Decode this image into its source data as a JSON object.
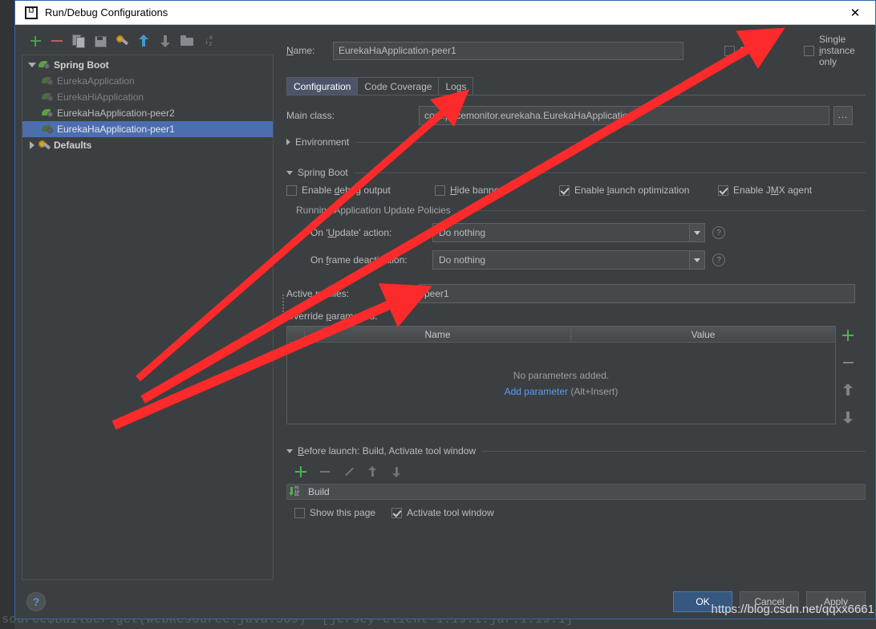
{
  "window": {
    "title": "Run/Debug Configurations",
    "logo_icon": "intellij-idea-logo",
    "close_icon": "close-icon"
  },
  "toolbar": {
    "icons": [
      {
        "name": "add-icon",
        "glyph": "+"
      },
      {
        "name": "remove-icon",
        "glyph": "−"
      },
      {
        "name": "copy-icon",
        "glyph": "copy"
      },
      {
        "name": "save-icon",
        "glyph": "save"
      },
      {
        "name": "edit-defaults-icon",
        "glyph": "gear"
      },
      {
        "name": "move-up-icon",
        "glyph": "up"
      },
      {
        "name": "move-down-icon",
        "glyph": "down"
      },
      {
        "name": "folder-icon",
        "glyph": "folder"
      },
      {
        "name": "sort-icon",
        "glyph": "↓az"
      }
    ]
  },
  "tree": {
    "nodes": [
      {
        "label": "Spring Boot",
        "icon": "spring-boot-icon",
        "style": "bold",
        "twisty": "down",
        "indent": 0,
        "selected": false
      },
      {
        "label": "EurekaApplication",
        "icon": "spring-boot-icon",
        "style": "dim",
        "twisty": "none",
        "indent": 1,
        "selected": false
      },
      {
        "label": "EurekaHiApplication",
        "icon": "spring-boot-icon",
        "style": "dim",
        "twisty": "none",
        "indent": 1,
        "selected": false
      },
      {
        "label": "EurekaHaApplication-peer2",
        "icon": "spring-boot-icon",
        "style": "normal",
        "twisty": "none",
        "indent": 1,
        "selected": false
      },
      {
        "label": "EurekaHaApplication-peer1",
        "icon": "spring-boot-icon",
        "style": "dim",
        "twisty": "none",
        "indent": 1,
        "selected": true
      },
      {
        "label": "Defaults",
        "icon": "wrench-icon",
        "style": "bold",
        "twisty": "right",
        "indent": 0,
        "selected": false
      }
    ]
  },
  "form": {
    "name_label": "Name:",
    "name_value": "EurekaHaApplication-peer1",
    "share_label": "Share",
    "share_checked": false,
    "single_instance_label": "Single instance only",
    "single_instance_checked": false,
    "tabs": [
      {
        "label": "Configuration",
        "active": true
      },
      {
        "label": "Code Coverage",
        "active": false
      },
      {
        "label": "Logs",
        "active": false
      }
    ],
    "main_class_label": "Main class:",
    "main_class_value": "com.pricemonitor.eurekaha.EurekaHaApplication",
    "browse_button_label": "...",
    "environment_section": "Environment",
    "spring_boot_section": "Spring Boot",
    "spring_checks": [
      {
        "label": "Enable debug output",
        "checked": false,
        "mnemonic": "d"
      },
      {
        "label": "Hide banner",
        "checked": false,
        "mnemonic": "H"
      },
      {
        "label": "Enable launch optimization",
        "checked": true,
        "mnemonic": "l"
      },
      {
        "label": "Enable JMX agent",
        "checked": true,
        "mnemonic": "M"
      }
    ],
    "update_policies_label": "Running Application Update Policies",
    "on_update_label": "On 'Update' action:",
    "on_update_value": "Do nothing",
    "on_frame_label": "On frame deactivation:",
    "on_frame_value": "Do nothing",
    "help_icon": "question-mark-icon",
    "active_profiles_label": "Active profiles:",
    "active_profiles_value": "peer1",
    "override_params_label": "Override parameters:",
    "params_columns": [
      "Name",
      "Value"
    ],
    "params_empty_text": "No parameters added.",
    "params_add_link": "Add parameter",
    "params_add_hint": "(Alt+Insert)",
    "params_side_icons": [
      {
        "name": "add-parameter-icon"
      },
      {
        "name": "remove-parameter-icon"
      },
      {
        "name": "move-parameter-up-icon"
      },
      {
        "name": "move-parameter-down-icon"
      }
    ]
  },
  "before_launch": {
    "header": "Before launch: Build, Activate tool window",
    "toolbar_icons": [
      {
        "name": "add-task-icon"
      },
      {
        "name": "remove-task-icon"
      },
      {
        "name": "edit-task-icon"
      },
      {
        "name": "move-task-up-icon"
      },
      {
        "name": "move-task-down-icon"
      }
    ],
    "task_label": "Build",
    "task_icon": "build-icon",
    "show_page_label": "Show this page",
    "show_page_checked": false,
    "activate_window_label": "Activate tool window",
    "activate_window_checked": true
  },
  "footer": {
    "help_label": "?",
    "ok_label": "OK",
    "cancel_label": "Cancel",
    "apply_label": "Apply"
  },
  "overlay": {
    "watermark": "https://blog.csdn.net/qqxx6661",
    "background_code": "source$Builder.get(WebResource.java:509) ~[jersey-client-1.19.1.jar:1.19.1]",
    "arrow_color": "#fc2a2a"
  }
}
